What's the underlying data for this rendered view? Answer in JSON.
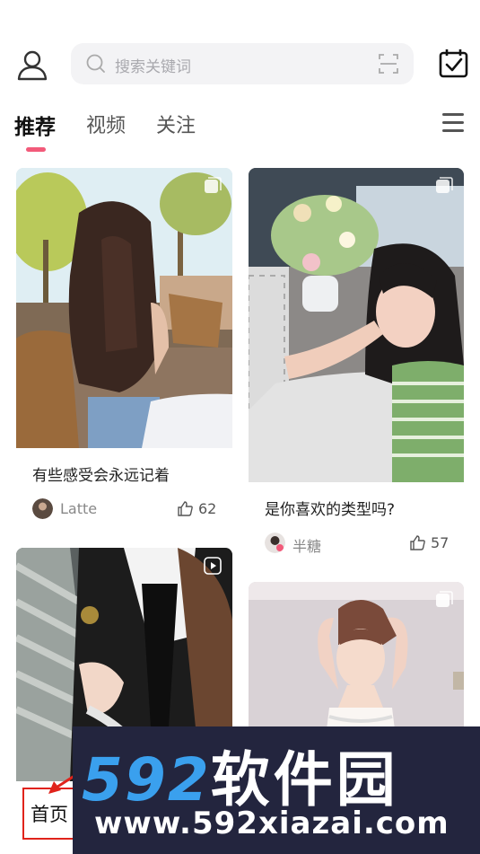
{
  "header": {
    "search_placeholder": "搜索关键词",
    "icons": [
      "user-icon",
      "search-icon",
      "scan-icon",
      "calendar-check-icon"
    ]
  },
  "tabs": [
    {
      "label": "推荐",
      "active": true
    },
    {
      "label": "视频",
      "active": false
    },
    {
      "label": "关注",
      "active": false
    }
  ],
  "feed": [
    {
      "title": "有些感受会永远记着",
      "author": "Latte",
      "likes": "62",
      "media": "image-set"
    },
    {
      "title": "是你喜欢的类型吗?",
      "author": "半糖",
      "likes": "57",
      "media": "image-set"
    },
    {
      "title": "",
      "author": "",
      "likes": "",
      "media": "video"
    },
    {
      "title": "",
      "author": "",
      "likes": "",
      "media": "image-set"
    }
  ],
  "bottom_nav": {
    "home_label": "首页"
  },
  "watermark": {
    "brand_num": "592",
    "brand_cn": "软件园",
    "url": "www.592xiazai.com"
  },
  "colors": {
    "accent": "#f25a7a",
    "annotation": "#e0231b",
    "watermark_bg": "#23253e",
    "watermark_blue": "#3aa0ee"
  }
}
